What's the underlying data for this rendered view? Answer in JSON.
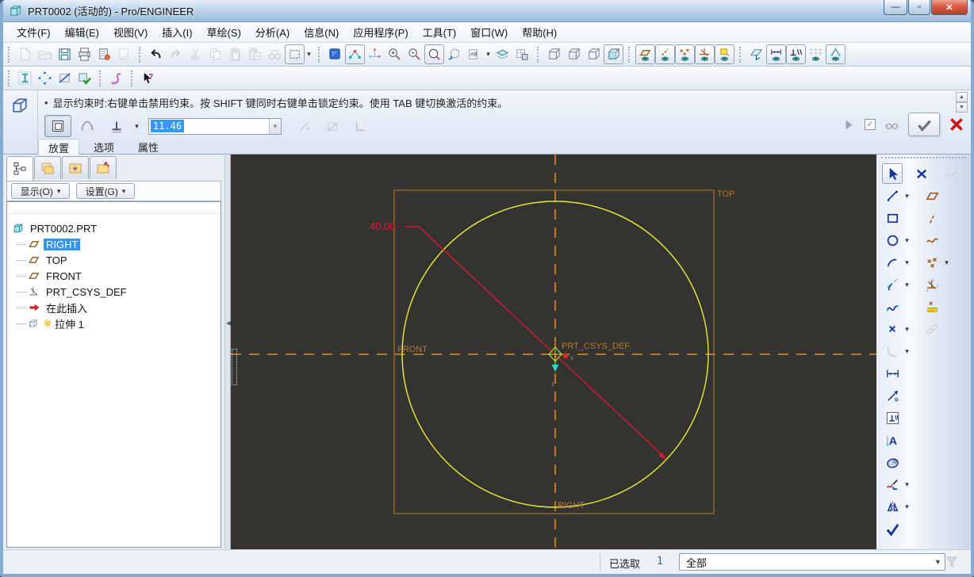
{
  "window": {
    "title": "PRT0002 (活动的) - Pro/ENGINEER",
    "controls": {
      "minimize": "—",
      "maximize": "▫",
      "close": "✕"
    }
  },
  "menu_bar": {
    "items": [
      "文件(F)",
      "编辑(E)",
      "视图(V)",
      "插入(I)",
      "草绘(S)",
      "分析(A)",
      "信息(N)",
      "应用程序(P)",
      "工具(T)",
      "窗口(W)",
      "帮助(H)"
    ]
  },
  "toolbar_main": {
    "groups": [
      {
        "items": [
          {
            "icon": "new-file",
            "dim": true
          },
          {
            "icon": "open-folder",
            "dim": true
          },
          {
            "icon": "save"
          },
          {
            "icon": "print"
          },
          {
            "icon": "print-setup"
          },
          {
            "icon": "send-mail",
            "dim": true
          }
        ]
      },
      {
        "items": [
          {
            "icon": "undo"
          },
          {
            "icon": "redo",
            "dim": true
          },
          {
            "icon": "cut",
            "dim": true
          },
          {
            "icon": "copy",
            "dim": true
          },
          {
            "icon": "paste",
            "dim": true
          },
          {
            "icon": "paste-special",
            "dim": true
          },
          {
            "icon": "find",
            "dim": true
          },
          {
            "icon": "select-box",
            "frame": true,
            "dd": true
          }
        ]
      },
      {
        "items": [
          {
            "icon": "shade-model"
          },
          {
            "icon": "spin-center",
            "frame": true
          },
          {
            "icon": "orient-mode"
          },
          {
            "icon": "zoom-in"
          },
          {
            "icon": "zoom-out"
          },
          {
            "icon": "refit",
            "frame": true
          },
          {
            "icon": "view-manager"
          },
          {
            "icon": "saved-views",
            "dd": true
          },
          {
            "icon": "layers"
          },
          {
            "icon": "layer-settings"
          }
        ]
      },
      {
        "items": [
          {
            "icon": "wireframe"
          },
          {
            "icon": "hidden-line"
          },
          {
            "icon": "no-hidden"
          },
          {
            "icon": "shaded",
            "frame": true
          }
        ]
      },
      {
        "items": [
          {
            "icon": "plane-display",
            "frame": true
          },
          {
            "icon": "axis-display",
            "frame": true
          },
          {
            "icon": "point-display",
            "frame": true
          },
          {
            "icon": "csys-display",
            "frame": true
          },
          {
            "icon": "note-display",
            "frame": true
          }
        ]
      },
      {
        "items": [
          {
            "icon": "sketch-orient"
          },
          {
            "icon": "dim-display",
            "frame": true
          },
          {
            "icon": "constraint-display",
            "frame": true
          },
          {
            "icon": "grid-display"
          },
          {
            "icon": "vertex-display",
            "frame": true
          }
        ]
      }
    ]
  },
  "toolbar_secondary": {
    "groups": [
      {
        "items": [
          {
            "icon": "grid-ibeam"
          },
          {
            "icon": "grid-diamond"
          },
          {
            "icon": "no-clip"
          },
          {
            "icon": "grid-ok"
          }
        ]
      },
      {
        "items": [
          {
            "icon": "spray-curve"
          }
        ]
      },
      {
        "items": [
          {
            "icon": "context-help"
          }
        ]
      }
    ]
  },
  "message_bar": {
    "bullet": "•",
    "text": "显示约束时:右键单击禁用约束。按 SHIFT 键同时右键单击锁定约束。使用 TAB 键切换激活的约束。"
  },
  "dashboard": {
    "feature_icon": "extrude-feature",
    "type_buttons": [
      {
        "icon": "solid-type",
        "pressed": true
      },
      {
        "icon": "surface-type"
      },
      {
        "icon": "depth-blind",
        "dd": true
      }
    ],
    "depth_value": "11.46",
    "side_icons": [
      {
        "icon": "flip-direction",
        "dim": true
      },
      {
        "icon": "remove-material",
        "dim": true
      },
      {
        "icon": "thicken",
        "dim": true
      }
    ],
    "tabs": [
      {
        "label": "放置",
        "active": true
      },
      {
        "label": "选项",
        "active": false
      },
      {
        "label": "属性",
        "active": false
      }
    ],
    "right_controls": {
      "play_icon": "play",
      "preview_check": "✓",
      "glasses_icon": "glasses",
      "ok_icon": "ok-check",
      "cancel_icon": "cancel-x"
    }
  },
  "model_tree": {
    "tabs": [
      "tree-view",
      "folder-browser",
      "favorites",
      "connections"
    ],
    "header_buttons": [
      {
        "label": "显示(O)"
      },
      {
        "label": "设置(G)"
      }
    ],
    "items": [
      {
        "icon": "part",
        "label": "PRT0002.PRT",
        "indent": 0,
        "selected": false
      },
      {
        "icon": "datum-plane",
        "label": "RIGHT",
        "indent": 1,
        "selected": true
      },
      {
        "icon": "datum-plane",
        "label": "TOP",
        "indent": 1,
        "selected": false
      },
      {
        "icon": "datum-plane",
        "label": "FRONT",
        "indent": 1,
        "selected": false
      },
      {
        "icon": "csys",
        "label": "PRT_CSYS_DEF",
        "indent": 1,
        "selected": false
      },
      {
        "icon": "insert-here",
        "label": "在此插入",
        "indent": 1,
        "selected": false
      },
      {
        "icon": "extrude",
        "label": "拉伸 1",
        "indent": 1,
        "selected": false,
        "pending_mark": "※"
      }
    ]
  },
  "canvas": {
    "background": "#34332f",
    "labels": {
      "top": "TOP",
      "front": "FRONT",
      "right": "RIGHT",
      "csys": "PRT_CSYS_DEF"
    },
    "dimension_value": "40.00",
    "colors": {
      "circle": "#ecec38",
      "datum_outline": "#a06a2e",
      "centerline": "#ef8a10",
      "label": "#b07c34",
      "dimension": "#ee1438"
    }
  },
  "right_toolbar": {
    "rows": [
      [
        {
          "icon": "select-arrow",
          "frame": true
        },
        {
          "icon": "close-x"
        },
        {
          "icon": "curve-wave",
          "dim": true
        }
      ],
      [
        {
          "icon": "line-tool",
          "dd": true
        },
        {
          "icon": "datum-plane-tool"
        }
      ],
      [
        {
          "icon": "rect-tool"
        },
        {
          "icon": "datum-axis-tool"
        }
      ],
      [
        {
          "icon": "circle-tool",
          "dd": true
        },
        {
          "icon": "datum-curve-tool"
        }
      ],
      [
        {
          "icon": "arc-tool",
          "dd": true
        },
        {
          "icon": "datum-point-tool",
          "dd": true
        }
      ],
      [
        {
          "icon": "fillet-tool",
          "dd": true
        },
        {
          "icon": "datum-csys-tool"
        }
      ],
      [
        {
          "icon": "spline-tool"
        },
        {
          "icon": "point-hatch-tool"
        }
      ],
      [
        {
          "icon": "point-tool",
          "dd": true
        },
        {
          "icon": "use-edge-tool",
          "dim": true
        }
      ],
      [
        {
          "icon": "chamfer-tool",
          "dim": true,
          "dd": true
        }
      ],
      [
        {
          "icon": "dimension-tool"
        }
      ],
      [
        {
          "icon": "modify-tool"
        }
      ],
      [
        {
          "icon": "constraint-tool"
        }
      ],
      [
        {
          "icon": "text-tool"
        }
      ],
      [
        {
          "icon": "palette-tool"
        }
      ],
      [
        {
          "icon": "trim-tool",
          "dd": true
        }
      ],
      [
        {
          "icon": "mirror-tool",
          "dd": true
        }
      ],
      [
        {
          "icon": "done-check"
        }
      ]
    ]
  },
  "status_bar": {
    "selected_label": "已选取",
    "selected_count": "1",
    "filter_dropdown": "全部",
    "filter_icon": "funnel"
  }
}
